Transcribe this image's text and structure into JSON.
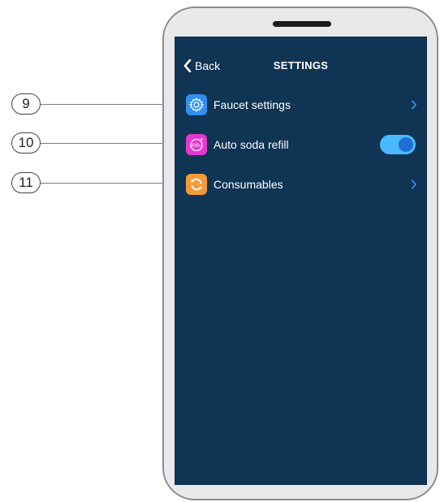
{
  "header": {
    "back_label": "Back",
    "title": "SETTINGS"
  },
  "rows": [
    {
      "label": "Faucet settings",
      "icon": "gear-icon",
      "icon_color": "#2f8ff2",
      "control": "chevron"
    },
    {
      "label": "Auto soda refill",
      "icon": "co2-icon",
      "icon_color": "#e637d0",
      "control": "toggle",
      "toggle_on": true
    },
    {
      "label": "Consumables",
      "icon": "refresh-icon",
      "icon_color": "#f59a36",
      "control": "chevron"
    }
  ],
  "callouts": [
    "9",
    "10",
    "11"
  ],
  "colors": {
    "screen_background": "#103453",
    "accent": "#2f8ff2",
    "toggle_track": "#4ab9ff",
    "toggle_knob": "#1d6fd6",
    "text": "#ffffff"
  }
}
